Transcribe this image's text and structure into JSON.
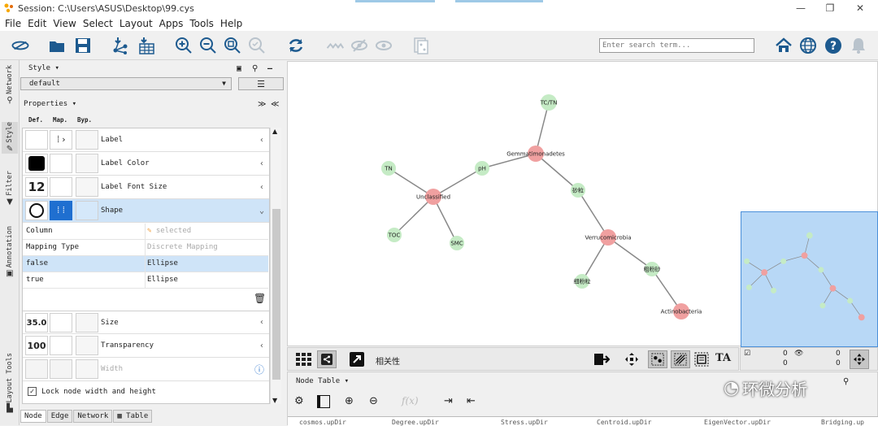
{
  "window": {
    "title": "Session: C:\\Users\\ASUS\\Desktop\\99.cys"
  },
  "menu": [
    "File",
    "Edit",
    "View",
    "Select",
    "Layout",
    "Apps",
    "Tools",
    "Help"
  ],
  "search": {
    "placeholder": "Enter search term..."
  },
  "left_tabs": [
    "Network",
    "Style",
    "Filter",
    "Annotation",
    "Layout Tools"
  ],
  "style_panel": {
    "header": "Style ▾",
    "style_name": "default",
    "properties_header": "Properties ▾",
    "columns": [
      "Def.",
      "Map.",
      "Byp."
    ],
    "properties": [
      {
        "label": "Label"
      },
      {
        "label": "Label Color"
      },
      {
        "label": "Label Font Size",
        "default_value": "12"
      },
      {
        "label": "Shape"
      },
      {
        "label": "Size",
        "default_value": "35.0"
      },
      {
        "label": "Transparency",
        "default_value": "100"
      },
      {
        "label": "Width"
      }
    ],
    "shape_mapping": {
      "column_key": "Column",
      "column_value": "selected",
      "type_key": "Mapping Type",
      "type_value": "Discrete Mapping",
      "rows": [
        {
          "key": "false",
          "value": "Ellipse"
        },
        {
          "key": "true",
          "value": "Ellipse"
        }
      ]
    },
    "lock_label": "Lock node width and height",
    "lock_checked": true
  },
  "bottom_tabs": [
    "Node",
    "Edge",
    "Network",
    "Table"
  ],
  "network": {
    "nodes": [
      {
        "id": "TC/TN",
        "label": "TC/TN",
        "color": "#c5ebc5"
      },
      {
        "id": "Gemmatimonadetes",
        "label": "Gemmatimonadetes",
        "color": "#f0a0a0"
      },
      {
        "id": "pH",
        "label": "pH",
        "color": "#c5ebc5"
      },
      {
        "id": "TN",
        "label": "TN",
        "color": "#c5ebc5"
      },
      {
        "id": "Unclassified",
        "label": "Unclassified",
        "color": "#f0a0a0"
      },
      {
        "id": "TOC",
        "label": "TOC",
        "color": "#c5ebc5"
      },
      {
        "id": "SMC",
        "label": "SMC",
        "color": "#c5ebc5"
      },
      {
        "id": "sand",
        "label": "砂粒",
        "color": "#c5ebc5"
      },
      {
        "id": "Verrucomicrobia",
        "label": "Verrucomicrobia",
        "color": "#f0a0a0"
      },
      {
        "id": "coarse_silt",
        "label": "粗粉砂",
        "color": "#c5ebc5"
      },
      {
        "id": "fine_silt",
        "label": "细粉粒",
        "color": "#c5ebc5"
      },
      {
        "id": "Actinobacteria",
        "label": "Actinobacteria",
        "color": "#f0a0a0"
      }
    ],
    "edges": [
      [
        "TC/TN",
        "Gemmatimonadetes"
      ],
      [
        "Gemmatimonadetes",
        "pH"
      ],
      [
        "pH",
        "Unclassified"
      ],
      [
        "TN",
        "Unclassified"
      ],
      [
        "Unclassified",
        "TOC"
      ],
      [
        "Unclassified",
        "SMC"
      ],
      [
        "Gemmatimonadetes",
        "sand"
      ],
      [
        "sand",
        "Verrucomicrobia"
      ],
      [
        "Verrucomicrobia",
        "fine_silt"
      ],
      [
        "Verrucomicrobia",
        "coarse_silt"
      ],
      [
        "coarse_silt",
        "Actinobacteria"
      ]
    ]
  },
  "net_toolbar": {
    "network_name": "相关性"
  },
  "net_info": {
    "left_count_top": "0",
    "left_count_bottom": "0",
    "right_count_top": "0",
    "right_count_bottom": "0"
  },
  "table_panel": {
    "title": "Node Table ▾",
    "column_headers": [
      "cosmos.upDir",
      "Degree.upDir",
      "Stress.upDir",
      "Centroid.upDir",
      "EigenVector.upDir",
      "Bridging.up"
    ]
  },
  "watermark": {
    "text": "环微分析"
  }
}
